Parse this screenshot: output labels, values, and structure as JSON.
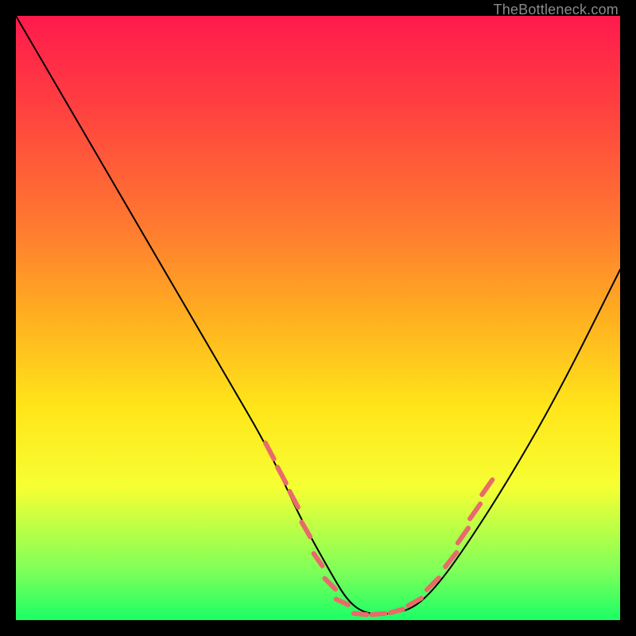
{
  "watermark": "TheBottleneck.com",
  "chart_data": {
    "type": "line",
    "title": "",
    "xlabel": "",
    "ylabel": "",
    "xlim": [
      0,
      100
    ],
    "ylim": [
      0,
      100
    ],
    "grid": false,
    "legend": null,
    "background_gradient": {
      "stops": [
        {
          "pos": 0,
          "color": "#ff1a4d"
        },
        {
          "pos": 15,
          "color": "#ff4040"
        },
        {
          "pos": 35,
          "color": "#ff7a30"
        },
        {
          "pos": 50,
          "color": "#ffb020"
        },
        {
          "pos": 65,
          "color": "#ffe61a"
        },
        {
          "pos": 78,
          "color": "#f6ff33"
        },
        {
          "pos": 92,
          "color": "#7dff5a"
        },
        {
          "pos": 100,
          "color": "#1aff66"
        }
      ]
    },
    "series": [
      {
        "name": "bottleneck-curve",
        "color": "#000000",
        "width": 2,
        "x": [
          0,
          7,
          14,
          21,
          28,
          35,
          42,
          47,
          52,
          55,
          58,
          62,
          66,
          70,
          75,
          82,
          90,
          100
        ],
        "y": [
          100,
          88,
          76,
          64,
          52,
          40,
          28,
          17,
          8,
          3,
          1,
          1,
          2,
          6,
          13,
          24,
          38,
          58
        ]
      }
    ],
    "markers": [
      {
        "name": "highlight-dashes",
        "color": "#e86a6a",
        "width": 6,
        "segments": [
          {
            "x": 42,
            "y": 28,
            "len": 3.0,
            "ang": -62
          },
          {
            "x": 44,
            "y": 24,
            "len": 3.0,
            "ang": -62
          },
          {
            "x": 46,
            "y": 20,
            "len": 3.0,
            "ang": -62
          },
          {
            "x": 48,
            "y": 15,
            "len": 2.8,
            "ang": -60
          },
          {
            "x": 50,
            "y": 10,
            "len": 2.5,
            "ang": -55
          },
          {
            "x": 52,
            "y": 6,
            "len": 2.5,
            "ang": -45
          },
          {
            "x": 54,
            "y": 3,
            "len": 2.2,
            "ang": -25
          },
          {
            "x": 57,
            "y": 1,
            "len": 2.2,
            "ang": -5
          },
          {
            "x": 60,
            "y": 1,
            "len": 2.2,
            "ang": 5
          },
          {
            "x": 63,
            "y": 1.5,
            "len": 2.2,
            "ang": 15
          },
          {
            "x": 66,
            "y": 3,
            "len": 2.5,
            "ang": 30
          },
          {
            "x": 69,
            "y": 6,
            "len": 2.8,
            "ang": 45
          },
          {
            "x": 72,
            "y": 10,
            "len": 3.0,
            "ang": 52
          },
          {
            "x": 74,
            "y": 14,
            "len": 3.0,
            "ang": 55
          },
          {
            "x": 76,
            "y": 18,
            "len": 3.0,
            "ang": 55
          },
          {
            "x": 78,
            "y": 22,
            "len": 3.0,
            "ang": 55
          }
        ]
      }
    ]
  }
}
